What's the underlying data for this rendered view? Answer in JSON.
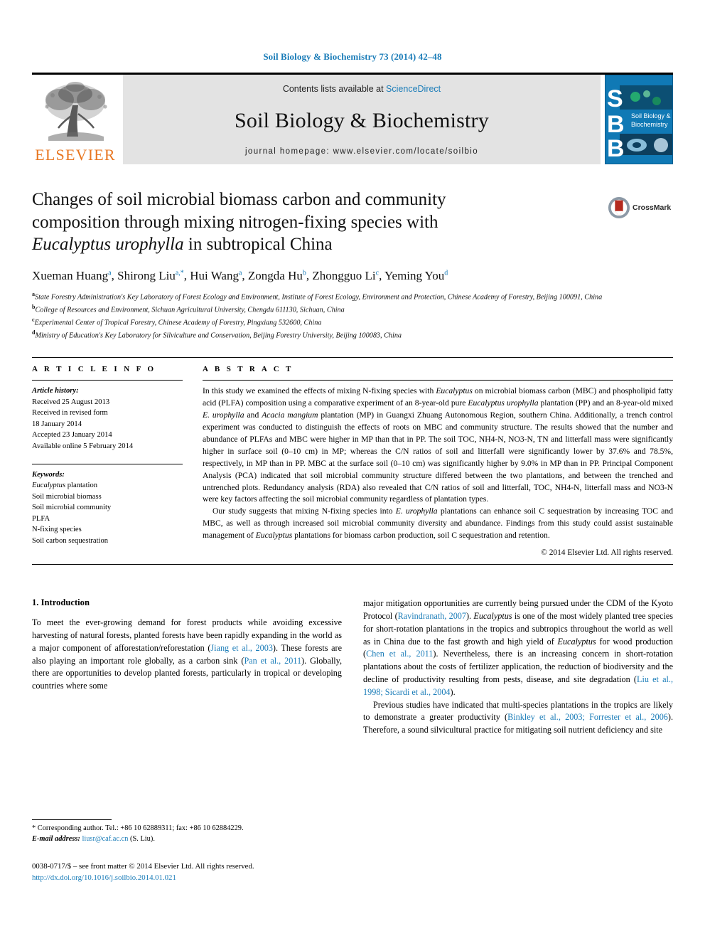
{
  "running_head": "Soil Biology & Biochemistry 73 (2014) 42–48",
  "masthead": {
    "contents_prefix": "Contents lists available at ",
    "sciencedirect": "ScienceDirect",
    "journal_title": "Soil Biology & Biochemistry",
    "homepage": "journal homepage: www.elsevier.com/locate/soilbio",
    "publisher": "ELSEVIER",
    "cover_letters": "SBB",
    "cover_title_line1": "Soil Biology &",
    "cover_title_line2": "Biochemistry"
  },
  "article": {
    "title_line1": "Changes of soil microbial biomass carbon and community",
    "title_line2": "composition through mixing nitrogen-fixing species with",
    "title_italic": "Eucalyptus urophylla",
    "title_line3_rest": " in subtropical China",
    "crossmark_label": "CrossMark",
    "authors": "Xueman Huang a, Shirong Liu a,*, Hui Wang a, Zongda Hu b, Zhongguo Li c, Yeming You d",
    "affiliations": [
      "State Forestry Administration's Key Laboratory of Forest Ecology and Environment, Institute of Forest Ecology, Environment and Protection, Chinese Academy of Forestry, Beijing 100091, China",
      "College of Resources and Environment, Sichuan Agricultural University, Chengdu 611130, Sichuan, China",
      "Experimental Center of Tropical Forestry, Chinese Academy of Forestry, Pingxiang 532600, China",
      "Ministry of Education's Key Laboratory for Silviculture and Conservation, Beijing Forestry University, Beijing 100083, China"
    ]
  },
  "article_info": {
    "heading": "A R T I C L E    I N F O",
    "history_label": "Article history:",
    "history": [
      "Received 25 August 2013",
      "Received in revised form",
      "18 January 2014",
      "Accepted 23 January 2014",
      "Available online 5 February 2014"
    ],
    "keywords_label": "Keywords:",
    "keywords": [
      "Eucalyptus plantation",
      "Soil microbial biomass",
      "Soil microbial community",
      "PLFA",
      "N-fixing species",
      "Soil carbon sequestration"
    ]
  },
  "abstract": {
    "heading": "A B S T R A C T",
    "paragraph1_a": "In this study we examined the effects of mixing N-fixing species with ",
    "paragraph1_b": "Eucalyptus",
    "paragraph1_c": " on microbial biomass carbon (MBC) and phospholipid fatty acid (PLFA) composition using a comparative experiment of an 8-year-old pure ",
    "paragraph1_d": "Eucalyptus urophylla",
    "paragraph1_e": " plantation (PP) and an 8-year-old mixed ",
    "paragraph1_f": "E. urophylla",
    "paragraph1_g": " and ",
    "paragraph1_h": "Acacia mangium",
    "paragraph1_i": " plantation (MP) in Guangxi Zhuang Autonomous Region, southern China. Additionally, a trench control experiment was conducted to distinguish the effects of roots on MBC and community structure. The results showed that the number and abundance of PLFAs and MBC were higher in MP than that in PP. The soil TOC, NH4-N, NO3-N, TN and litterfall mass were significantly higher in surface soil (0–10 cm) in MP; whereas the C/N ratios of soil and litterfall were significantly lower by 37.6% and 78.5%, respectively, in MP than in PP. MBC at the surface soil (0–10 cm) was significantly higher by 9.0% in MP than in PP. Principal Component Analysis (PCA) indicated that soil microbial community structure differed between the two plantations, and between the trenched and untrenched plots. Redundancy analysis (RDA) also revealed that C/N ratios of soil and litterfall, TOC, NH4-N, litterfall mass and NO3-N were key factors affecting the soil microbial community regardless of plantation types.",
    "paragraph2_a": "Our study suggests that mixing N-fixing species into ",
    "paragraph2_b": "E. urophylla",
    "paragraph2_c": " plantations can enhance soil C sequestration by increasing TOC and MBC, as well as through increased soil microbial community diversity and abundance. Findings from this study could assist sustainable management of ",
    "paragraph2_d": "Eucalyptus",
    "paragraph2_e": " plantations for biomass carbon production, soil C sequestration and retention.",
    "copyright": "© 2014 Elsevier Ltd. All rights reserved."
  },
  "introduction": {
    "section_title": "1. Introduction",
    "left_p1_a": "To meet the ever-growing demand for forest products while avoiding excessive harvesting of natural forests, planted forests have been rapidly expanding in the world as a major component of afforestation/reforestation (",
    "left_cite1": "Jiang et al., 2003",
    "left_p1_b": "). These forests are also playing an important role globally, as a carbon sink (",
    "left_cite2": "Pan et al., 2011",
    "left_p1_c": "). Globally, there are opportunities to develop planted forests, particularly in tropical or developing countries where some",
    "right_p1_a": "major mitigation opportunities are currently being pursued under the CDM of the Kyoto Protocol (",
    "right_cite1": "Ravindranath, 2007",
    "right_p1_b": "). ",
    "right_p1_italic": "Eucalyptus",
    "right_p1_c": " is one of the most widely planted tree species for short-rotation plantations in the tropics and subtropics throughout the world as well as in China due to the fast growth and high yield of ",
    "right_p1_italic2": "Eucalyptus",
    "right_p1_d": " for wood production (",
    "right_cite2": "Chen et al., 2011",
    "right_p1_e": "). Nevertheless, there is an increasing concern in short-rotation plantations about the costs of fertilizer application, the reduction of biodiversity and the decline of productivity resulting from pests, disease, and site degradation (",
    "right_cite3": "Liu et al., 1998; Sicardi et al., 2004",
    "right_p1_f": ").",
    "right_p2_a": "Previous studies have indicated that multi-species plantations in the tropics are likely to demonstrate a greater productivity (",
    "right_cite4": "Binkley et al., 2003; Forrester et al., 2006",
    "right_p2_b": "). Therefore, a sound silvicultural practice for mitigating soil nutrient deficiency and site"
  },
  "footnotes": {
    "corresponding": "* Corresponding author. Tel.: +86 10 62889311; fax: +86 10 62884229.",
    "email_label": "E-mail address:",
    "email": "liusr@caf.ac.cn",
    "email_suffix": " (S. Liu).",
    "issn_line": "0038-0717/$ – see front matter © 2014 Elsevier Ltd. All rights reserved.",
    "doi": "http://dx.doi.org/10.1016/j.soilbio.2014.01.021"
  },
  "colors": {
    "link": "#1a7cb8",
    "elsevier_orange": "#E87722",
    "band_gray": "#e3e3e3",
    "cover_blue": "#1079b5"
  }
}
